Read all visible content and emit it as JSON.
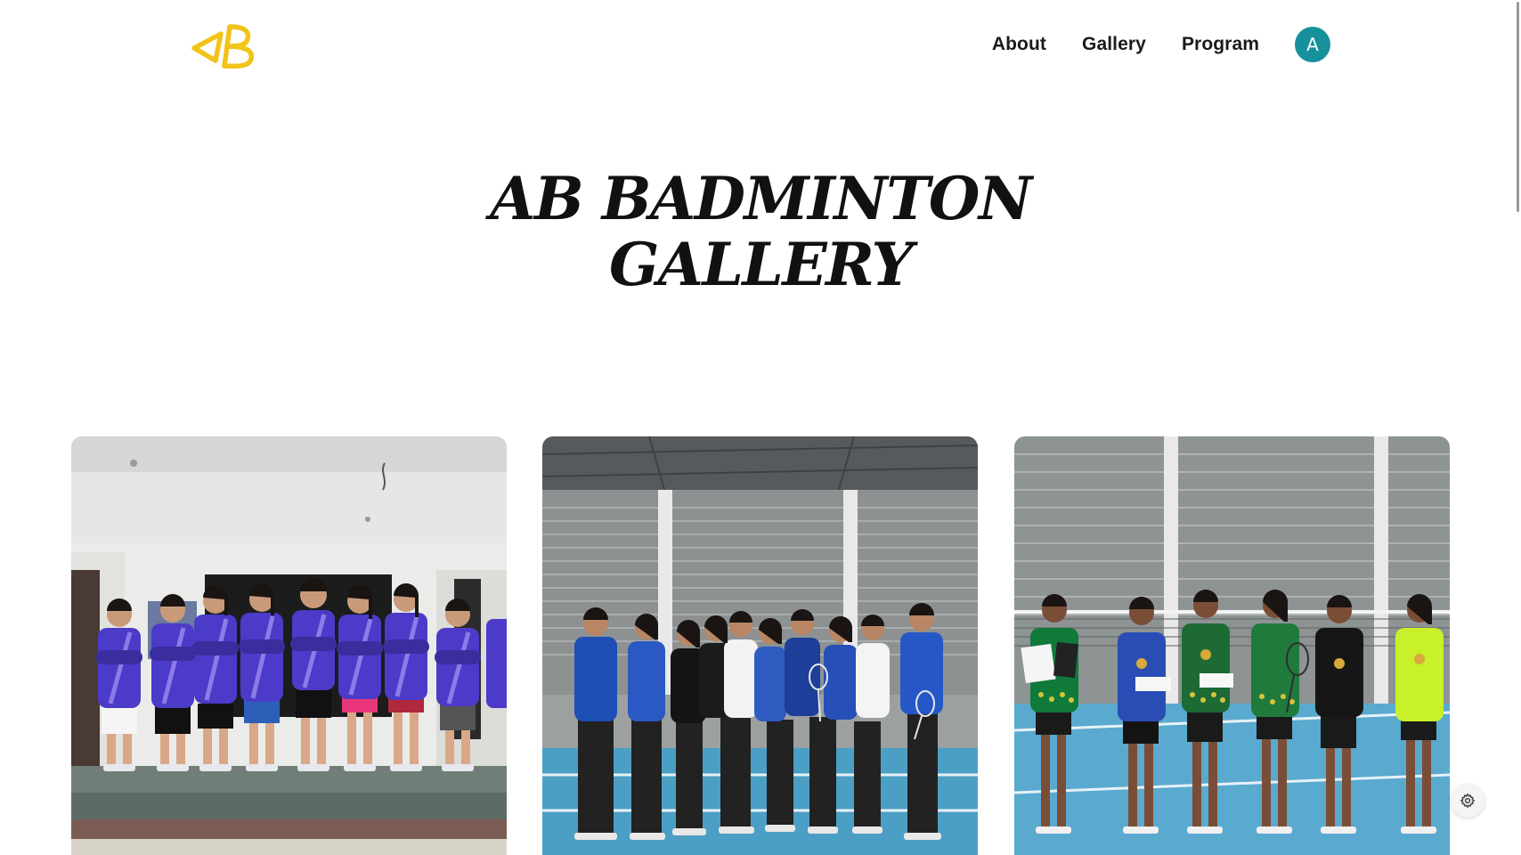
{
  "brand": {
    "logo_icon": "ab-monogram-logo",
    "logo_color": "#F2C318"
  },
  "nav": {
    "items": [
      {
        "label": "About"
      },
      {
        "label": "Gallery"
      },
      {
        "label": "Program"
      }
    ],
    "avatar": {
      "initial": "A",
      "color": "#16919C"
    }
  },
  "page": {
    "title_line1": "AB BADMINTON",
    "title_line2": "GALLERY"
  },
  "gallery": {
    "photos": [
      {
        "alt": "Players in purple AB Badminton jerseys posing with crossed arms",
        "jersey_color": "#4B3BC8"
      },
      {
        "alt": "Group photo of players and parents on a blue badminton court",
        "court_color": "#4C9FC4"
      },
      {
        "alt": "Young players with medals and certificates on badminton court",
        "court_color": "#5AA9CF"
      }
    ]
  },
  "settings": {
    "icon": "gear-icon"
  }
}
